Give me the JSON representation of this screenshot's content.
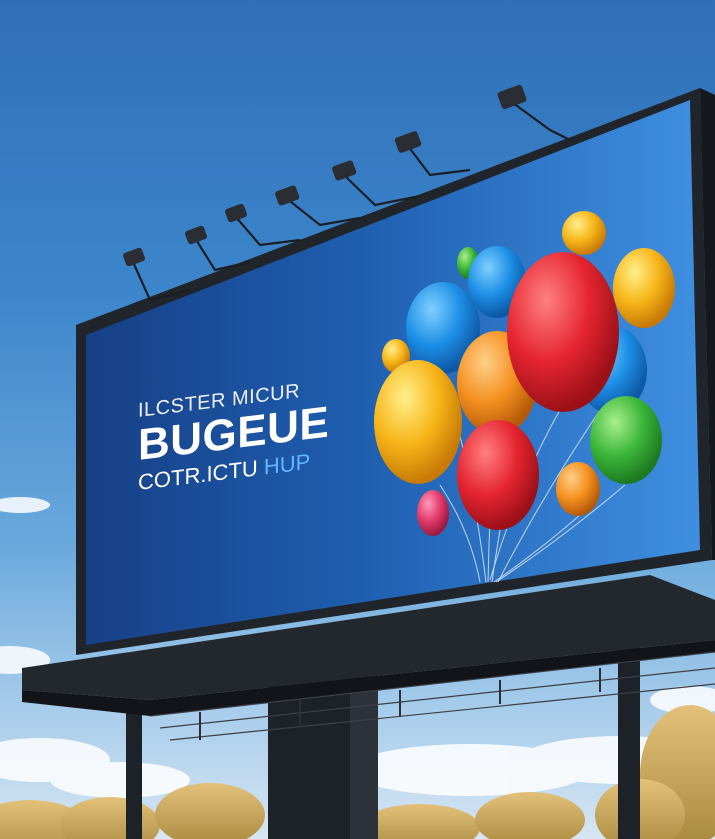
{
  "billboard": {
    "tagline": "ILCSTER MICUR",
    "headline": "BUGEUE",
    "subline_main": "COTR.ICTU",
    "subline_accent": "HUP"
  },
  "colors": {
    "sky_top": "#2f6fb8",
    "sky_bottom": "#d7e6f3",
    "billboard_face": "#1e4f9c",
    "frame": "#20242b",
    "accent_text": "#65b4ff"
  },
  "balloon_colors": [
    "red",
    "blue",
    "yellow",
    "orange",
    "green",
    "pink"
  ]
}
